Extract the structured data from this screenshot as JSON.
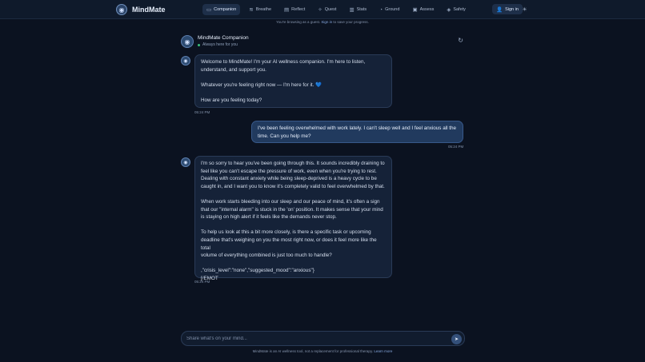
{
  "brand": {
    "name": "MindMate"
  },
  "nav": {
    "items": [
      {
        "label": "Companion",
        "icon": "chat-icon",
        "glyph": "▭"
      },
      {
        "label": "Breathe",
        "icon": "wind-icon",
        "glyph": "≋"
      },
      {
        "label": "Reflect",
        "icon": "book-icon",
        "glyph": "▤"
      },
      {
        "label": "Quest",
        "icon": "compass-icon",
        "glyph": "✧"
      },
      {
        "label": "Stats",
        "icon": "bar-chart-icon",
        "glyph": "▥"
      },
      {
        "label": "Ground",
        "icon": "leaf-icon",
        "glyph": "◔"
      },
      {
        "label": "Assess",
        "icon": "clipboard-icon",
        "glyph": "▣"
      },
      {
        "label": "Safety",
        "icon": "shield-icon",
        "glyph": "◈"
      }
    ],
    "active": "Companion",
    "signin_label": "Sign in"
  },
  "guest_notice": {
    "before": "You're browsing as a guest.",
    "link": "Sign in",
    "after": "to save your progress."
  },
  "chat_header": {
    "title": "MindMate Companion",
    "subtitle": "Always here for you"
  },
  "messages": [
    {
      "role": "assistant",
      "text": "Welcome to MindMate! I'm your AI wellness companion. I'm here to listen,\nunderstand, and support you.\n\nWhatever you're feeling right now — I'm here for it. 💙\n\nHow are you feeling today?",
      "time": "05:24 PM"
    },
    {
      "role": "user",
      "text": "I've been feeling overwhelmed with work lately. I can't sleep well and I feel anxious all the\ntime. Can you help me?",
      "time": "05:24 PM"
    },
    {
      "role": "assistant",
      "text": "I'm so sorry to hear you've been going through this. It sounds incredibly draining to\nfeel like you can't escape the pressure of work, even when you're trying to rest.\nDealing with constant anxiety while being sleep-deprived is a heavy cycle to be\ncaught in, and I want you to know it's completely valid to feel overwhelmed by that.\n\nWhen work starts bleeding into our sleep and our peace of mind, it's often a sign\nthat our \"internal alarm\" is stuck in the 'on' position. It makes sense that your mind\nis staying on high alert if it feels like the demands never stop.\n\nTo help us look at this a bit more closely, is there a specific task or upcoming\ndeadline that's weighing on you the most right now, or does it feel more like the total\nvolume of everything combined is just too much to handle?\n\n,\"crisis_level\":\"none\",\"suggested_mood\":\"anxious\"}\n[/EMOT",
      "time": "05:24 PM"
    }
  ],
  "composer": {
    "placeholder": "Share what's on your mind..."
  },
  "footer": {
    "text": "MindMate is an AI wellness tool, not a replacement for professional therapy.",
    "link": "Learn more"
  }
}
